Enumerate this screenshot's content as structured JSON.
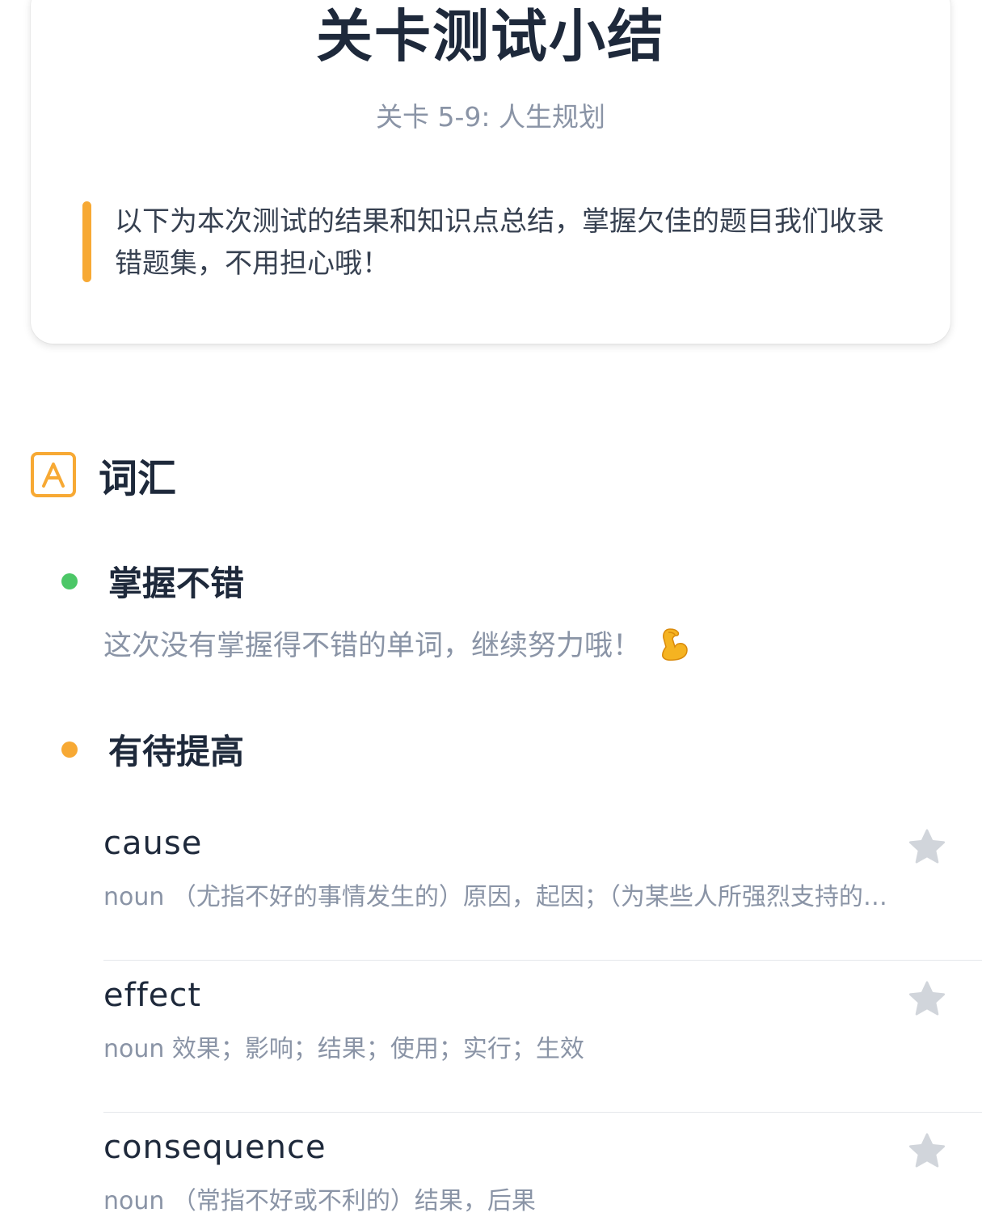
{
  "summary": {
    "title": "关卡测试小结",
    "subtitle": "关卡 5-9: 人生规划",
    "intro": "以下为本次测试的结果和知识点总结，掌握欠佳的题目我们收录错题集，不用担心哦！"
  },
  "vocab_section": {
    "icon_letter": "A",
    "title": "词汇",
    "good": {
      "title": "掌握不错",
      "message": "这次没有掌握得不错的单词，继续努力哦！",
      "dot_color": "#4cc767"
    },
    "improve": {
      "title": "有待提高",
      "dot_color": "#f7a934"
    },
    "words": [
      {
        "word": "cause",
        "definition": "noun （尤指不好的事情发生的）原因，起因；（为某些人所强烈支持的…"
      },
      {
        "word": "effect",
        "definition": "noun 效果；影响；结果；使用；实行；生效"
      },
      {
        "word": "consequence",
        "definition": "noun （常指不好或不利的）结果，后果"
      }
    ]
  },
  "colors": {
    "accent": "#f7a934",
    "title_text": "#1e293b",
    "muted_text": "#8a94a6",
    "star_inactive": "#d1d5db"
  }
}
